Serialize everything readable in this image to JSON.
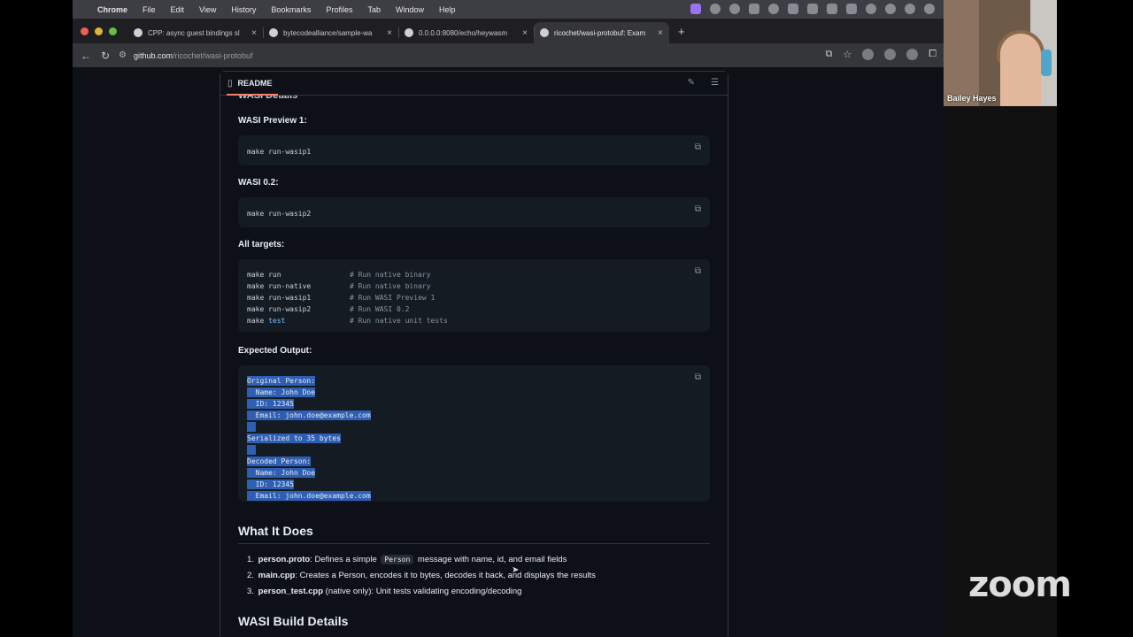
{
  "menubar": {
    "app": "Chrome",
    "items": [
      "File",
      "Edit",
      "View",
      "History",
      "Bookmarks",
      "Profiles",
      "Tab",
      "Window",
      "Help"
    ]
  },
  "tabs": [
    {
      "title": "CPP: async guest bindings sl",
      "active": false
    },
    {
      "title": "bytecodealliance/sample-wa",
      "active": false
    },
    {
      "title": "0.0.0.0:8080/echo/heywasm",
      "active": false
    },
    {
      "title": "ricochet/wasi-protobuf: Exam",
      "active": true
    }
  ],
  "address": {
    "host": "github.com",
    "path": "/ricochet/wasi-protobuf"
  },
  "readme": {
    "label": "README",
    "clipped_heading": "WASI Details",
    "preview1_heading": "WASI Preview 1:",
    "preview1_code": "make run-wasip1",
    "wasi02_heading": "WASI 0.2:",
    "wasi02_code": "make run-wasip2",
    "all_heading": "All targets:",
    "all_targets": [
      {
        "cmd": "make run",
        "kw": "",
        "comment": "# Run native binary"
      },
      {
        "cmd": "make run-native",
        "kw": "",
        "comment": "# Run native binary"
      },
      {
        "cmd": "make run-wasip1",
        "kw": "",
        "comment": "# Run WASI Preview 1"
      },
      {
        "cmd": "make run-wasip2",
        "kw": "",
        "comment": "# Run WASI 0.2"
      },
      {
        "cmd": "make ",
        "kw": "test",
        "comment": "# Run native unit tests"
      }
    ],
    "expected_heading": "Expected Output:",
    "expected_lines": [
      "Original Person:",
      "  Name: John Doe",
      "  ID: 12345",
      "  Email: john.doe@example.com",
      "",
      "Serialized to 35 bytes",
      "",
      "Decoded Person:",
      "  Name: John Doe",
      "  ID: 12345",
      "  Email: john.doe@example.com"
    ],
    "what_heading": "What It Does",
    "what_items": [
      {
        "num": "1.",
        "bold": "person.proto",
        "pre": ": Defines a simple ",
        "code": "Person",
        "post": " message with name, id, and email fields"
      },
      {
        "num": "2.",
        "bold": "main.cpp",
        "pre": ": Creates a Person, encodes it to bytes, decodes it back, and displays the results",
        "code": "",
        "post": ""
      },
      {
        "num": "3.",
        "bold": "person_test.cpp",
        "pre": " (native only): Unit tests validating encoding/decoding",
        "code": "",
        "post": ""
      }
    ],
    "build_heading": "WASI Build Details"
  },
  "zoom": {
    "participant_name": "Bailey Hayes",
    "logo": "zoom"
  },
  "colors": {
    "page_bg": "#0d1117",
    "selection": "#2f5fb3",
    "menubar": "#3d3d44"
  }
}
